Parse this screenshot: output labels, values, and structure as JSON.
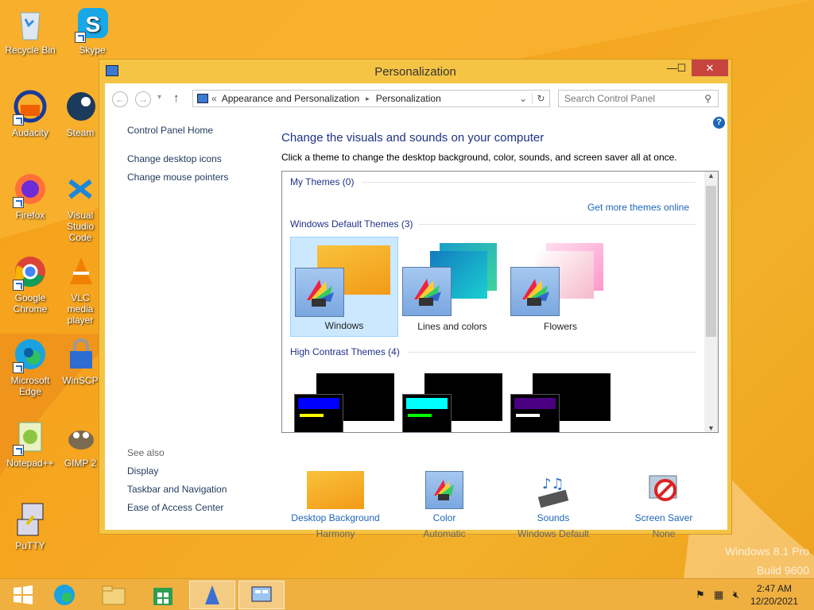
{
  "desktop": {
    "icons": [
      {
        "label": "Recycle Bin"
      },
      {
        "label": "Skype"
      },
      {
        "label": "Audacity"
      },
      {
        "label": "Steam"
      },
      {
        "label": "Firefox"
      },
      {
        "label": "Visual Studio Code"
      },
      {
        "label": "Google Chrome"
      },
      {
        "label": "VLC media player"
      },
      {
        "label": "Microsoft Edge"
      },
      {
        "label": "WinSCP"
      },
      {
        "label": "Notepad++"
      },
      {
        "label": "GIMP 2"
      },
      {
        "label": "PuTTY"
      }
    ],
    "watermark": {
      "line1": "Windows 8.1 Pro",
      "line2": "Build 9600"
    }
  },
  "window": {
    "title": "Personalization",
    "controls": {
      "minimize": "—",
      "maximize": "☐",
      "close": "✕"
    },
    "address": {
      "back": "←",
      "forward": "→",
      "up": "↑",
      "chevrons": "«",
      "crumb1": "Appearance and Personalization",
      "sep": "▸",
      "crumb2": "Personalization",
      "refresh": "↻",
      "dropdown": "⌄"
    },
    "search": {
      "placeholder": "Search Control Panel"
    },
    "help": "?",
    "left_nav": {
      "home": "Control Panel Home",
      "items": [
        "Change desktop icons",
        "Change mouse pointers"
      ]
    },
    "see_also": {
      "label": "See also",
      "items": [
        "Display",
        "Taskbar and Navigation",
        "Ease of Access Center"
      ]
    },
    "heading": "Change the visuals and sounds on your computer",
    "subheading": "Click a theme to change the desktop background, color, sounds, and screen saver all at once.",
    "themes": {
      "my_themes": "My Themes (0)",
      "get_more": "Get more themes online",
      "default_group": "Windows Default Themes (3)",
      "defaults": [
        "Windows",
        "Lines and colors",
        "Flowers"
      ],
      "high_contrast_group": "High Contrast Themes (4)"
    },
    "bottom": [
      {
        "title": "Desktop Background",
        "sub": "Harmony"
      },
      {
        "title": "Color",
        "sub": "Automatic"
      },
      {
        "title": "Sounds",
        "sub": "Windows Default"
      },
      {
        "title": "Screen Saver",
        "sub": "None"
      }
    ]
  },
  "taskbar": {
    "time": "2:47 AM",
    "date": "12/20/2021"
  }
}
